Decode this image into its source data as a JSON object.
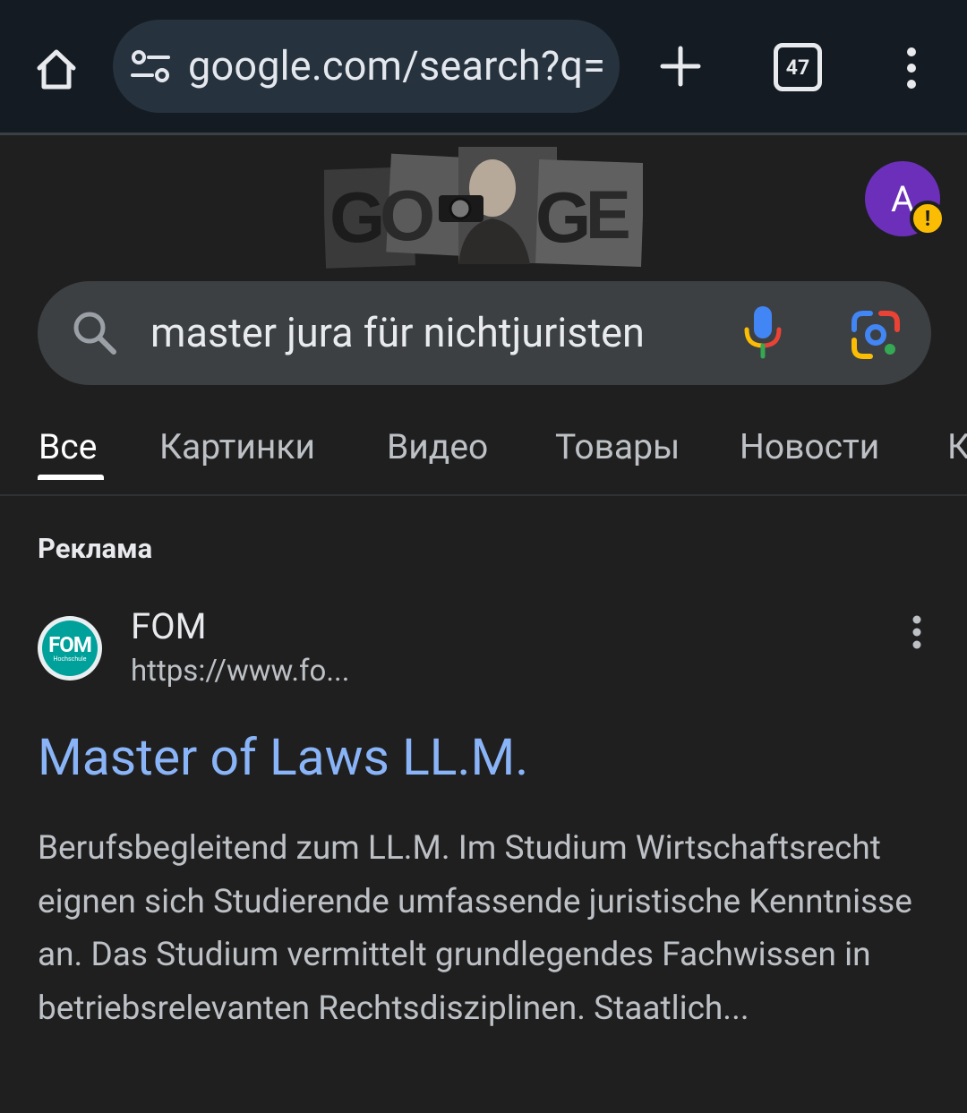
{
  "browser": {
    "url": "google.com/search?q=",
    "tab_count": "47"
  },
  "google": {
    "doodle_text": "GOOGLE",
    "avatar_letter": "A",
    "alert_mark": "!",
    "search_query": "master jura für nichtjuristen"
  },
  "tabs": [
    {
      "label": "Все",
      "active": true
    },
    {
      "label": "Картинки"
    },
    {
      "label": "Видео"
    },
    {
      "label": "Товары"
    },
    {
      "label": "Новости"
    },
    {
      "label": "К"
    }
  ],
  "ad": {
    "label": "Реклама",
    "favicon_text": "FOM",
    "favicon_sub": "Hochschule",
    "site_name": "FOM",
    "site_url": "https://www.fo...",
    "title": "Master of Laws LL.M.",
    "snippet": "Berufsbegleitend zum LL.M. Im Studium Wirtschaftsrecht eignen sich Studierende umfassende juristische Kenntnisse an. Das Studium vermittelt grundlegendes Fachwissen in betriebsrelevanten Rechtsdisziplinen. Staatlich..."
  },
  "colors": {
    "toolbar_bg": "#141b22",
    "page_bg": "#1f1f1f",
    "link": "#8ab4f8",
    "avatar": "#6b2fba",
    "badge": "#fbbc04",
    "fom_teal": "#00a19a"
  }
}
